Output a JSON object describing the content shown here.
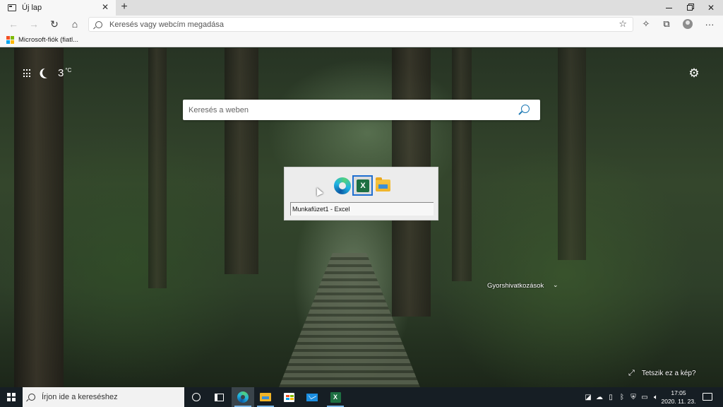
{
  "browser": {
    "tab_title": "Új lap",
    "tab_close": "✕",
    "new_tab": "+",
    "address_placeholder": "Keresés vagy webcím megadása",
    "favorite_label": "Microsoft-fiók (fiatl...",
    "ms_logo_colors": [
      "#f25022",
      "#7fba00",
      "#00a4ef",
      "#ffb900"
    ]
  },
  "page": {
    "weather_temp": "3",
    "weather_unit": "°C",
    "search_placeholder": "Keresés a weben",
    "quick_links_label": "Gyorshivatkozások",
    "like_image_label": "Tetszik ez a kép?"
  },
  "switcher": {
    "selected_window": "Munkafüzet1 - Excel",
    "apps": [
      "edge-icon",
      "excel-icon",
      "file-explorer-icon"
    ]
  },
  "taskbar": {
    "search_placeholder": "Írjon ide a kereséshez",
    "time": "17:05",
    "date": "2020. 11. 23."
  }
}
